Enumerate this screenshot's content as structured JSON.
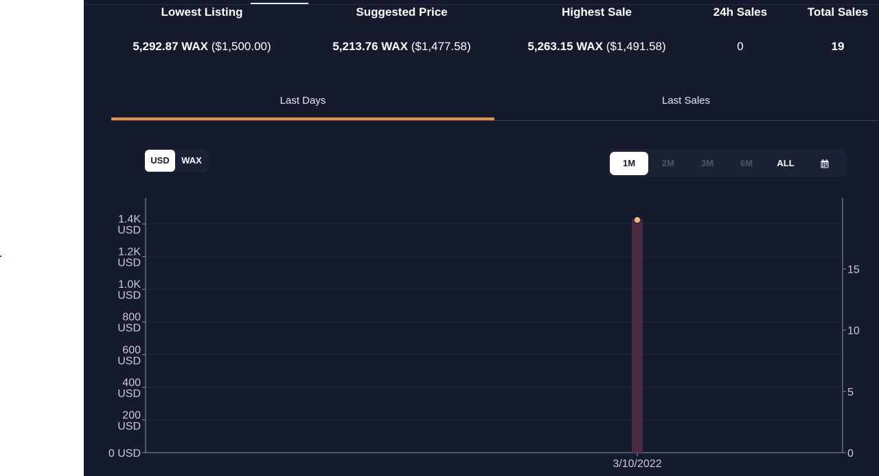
{
  "stats": [
    {
      "label": "Lowest Listing",
      "wax": "5,292.87 WAX",
      "usd": "($1,500.00)"
    },
    {
      "label": "Suggested Price",
      "wax": "5,213.76 WAX",
      "usd": "($1,477.58)"
    },
    {
      "label": "Highest Sale",
      "wax": "5,263.15 WAX",
      "usd": "($1,491.58)"
    },
    {
      "label": "24h Sales",
      "wax": "0",
      "usd": ""
    },
    {
      "label": "Total Sales",
      "wax": "19",
      "usd": ""
    }
  ],
  "tabs": {
    "last_days": "Last Days",
    "last_sales": "Last Sales",
    "active": "last_days"
  },
  "currency_toggle": {
    "usd": "USD",
    "wax": "WAX",
    "active": "usd"
  },
  "range_toggle": {
    "m1": "1M",
    "m2": "2M",
    "m3": "3M",
    "m6": "6M",
    "all": "ALL",
    "calendar_icon": "calendar-icon",
    "active": "1M"
  },
  "colors": {
    "accent": "#e8914a",
    "background": "#151a2c",
    "bar": "#4a2a3d",
    "point": "#f2b05c"
  },
  "chart_data": {
    "type": "bar",
    "categories": [
      "3/10/2022"
    ],
    "series": [
      {
        "axis": "left",
        "kind": "bar",
        "values": [
          1430
        ]
      },
      {
        "axis": "right",
        "kind": "point",
        "values": [
          19
        ]
      }
    ],
    "y_left": {
      "ticks": [
        {
          "v": 0,
          "l1": "0 USD",
          "l2": ""
        },
        {
          "v": 200,
          "l1": "200",
          "l2": "USD"
        },
        {
          "v": 400,
          "l1": "400",
          "l2": "USD"
        },
        {
          "v": 600,
          "l1": "600",
          "l2": "USD"
        },
        {
          "v": 800,
          "l1": "800",
          "l2": "USD"
        },
        {
          "v": 1000,
          "l1": "1.0K",
          "l2": "USD"
        },
        {
          "v": 1200,
          "l1": "1.2K",
          "l2": "USD"
        },
        {
          "v": 1400,
          "l1": "1.4K",
          "l2": "USD"
        }
      ],
      "ylim": [
        0,
        1560
      ]
    },
    "y_right": {
      "ticks": [
        "0",
        "5",
        "10",
        "15"
      ],
      "ylim": [
        0,
        20.8
      ]
    },
    "x_label": "3/10/2022",
    "grid": true
  }
}
